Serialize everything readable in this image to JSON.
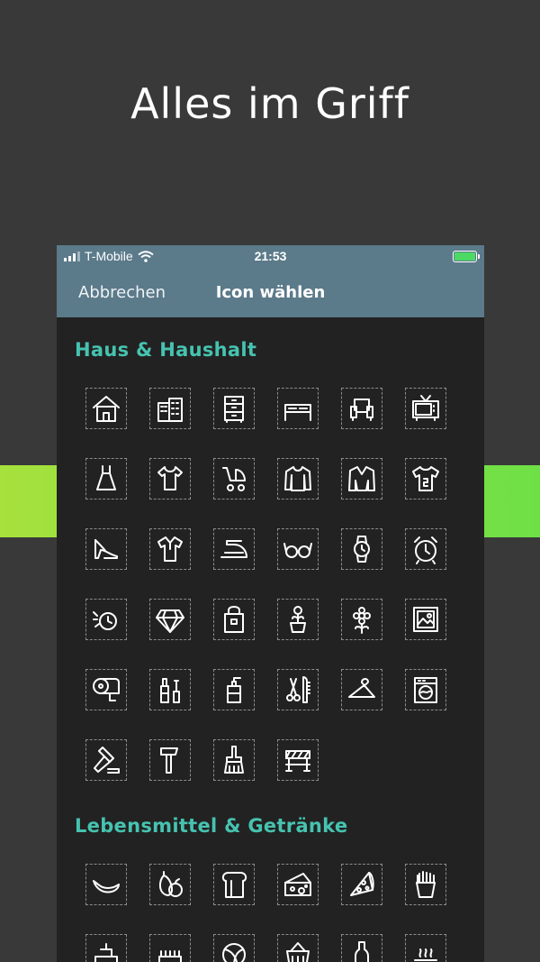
{
  "headline": "Alles im Griff",
  "status_bar": {
    "carrier": "T-Mobile",
    "time": "21:53"
  },
  "nav": {
    "cancel_label": "Abbrechen",
    "title": "Icon wählen"
  },
  "sections": [
    {
      "title": "Haus & Haushalt",
      "icons": [
        "house-icon",
        "buildings-icon",
        "dresser-icon",
        "bed-icon",
        "armchair-icon",
        "tv-icon",
        "dress-icon",
        "baby-bodysuit-icon",
        "stroller-icon",
        "sweater-icon",
        "jacket-icon",
        "jersey-icon",
        "high-heel-icon",
        "polo-shirt-icon",
        "iron-icon",
        "glasses-icon",
        "wristwatch-icon",
        "alarm-clock-icon",
        "wall-clock-icon",
        "diamond-icon",
        "handbag-icon",
        "potted-flower-icon",
        "flower-icon",
        "picture-icon",
        "toilet-paper-icon",
        "cosmetics-icon",
        "soap-dispenser-icon",
        "scissors-comb-icon",
        "hanger-icon",
        "washing-machine-icon",
        "gavel-icon",
        "hammer-icon",
        "paint-brush-icon",
        "barrier-icon"
      ]
    },
    {
      "title": "Lebensmittel & Getränke",
      "icons": [
        "banana-icon",
        "fruit-icon",
        "bread-icon",
        "cheese-icon",
        "pizza-icon",
        "fries-icon",
        "cake-icon",
        "candles-icon",
        "ball-icon",
        "basket-icon",
        "bottle-icon",
        "steam-icon"
      ]
    }
  ]
}
